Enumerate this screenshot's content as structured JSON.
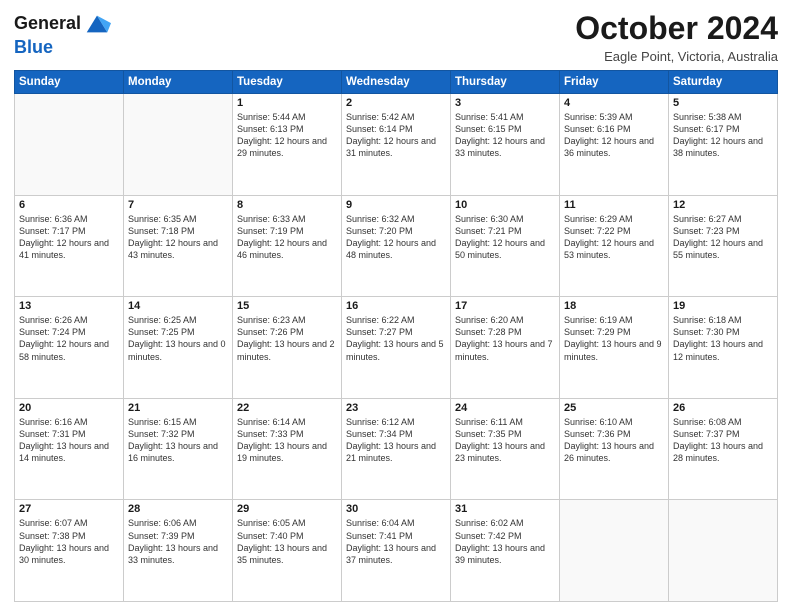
{
  "header": {
    "logo_line1": "General",
    "logo_line2": "Blue",
    "month": "October 2024",
    "location": "Eagle Point, Victoria, Australia"
  },
  "days_of_week": [
    "Sunday",
    "Monday",
    "Tuesday",
    "Wednesday",
    "Thursday",
    "Friday",
    "Saturday"
  ],
  "weeks": [
    [
      {
        "day": "",
        "info": ""
      },
      {
        "day": "",
        "info": ""
      },
      {
        "day": "1",
        "info": "Sunrise: 5:44 AM\nSunset: 6:13 PM\nDaylight: 12 hours and 29 minutes."
      },
      {
        "day": "2",
        "info": "Sunrise: 5:42 AM\nSunset: 6:14 PM\nDaylight: 12 hours and 31 minutes."
      },
      {
        "day": "3",
        "info": "Sunrise: 5:41 AM\nSunset: 6:15 PM\nDaylight: 12 hours and 33 minutes."
      },
      {
        "day": "4",
        "info": "Sunrise: 5:39 AM\nSunset: 6:16 PM\nDaylight: 12 hours and 36 minutes."
      },
      {
        "day": "5",
        "info": "Sunrise: 5:38 AM\nSunset: 6:17 PM\nDaylight: 12 hours and 38 minutes."
      }
    ],
    [
      {
        "day": "6",
        "info": "Sunrise: 6:36 AM\nSunset: 7:17 PM\nDaylight: 12 hours and 41 minutes."
      },
      {
        "day": "7",
        "info": "Sunrise: 6:35 AM\nSunset: 7:18 PM\nDaylight: 12 hours and 43 minutes."
      },
      {
        "day": "8",
        "info": "Sunrise: 6:33 AM\nSunset: 7:19 PM\nDaylight: 12 hours and 46 minutes."
      },
      {
        "day": "9",
        "info": "Sunrise: 6:32 AM\nSunset: 7:20 PM\nDaylight: 12 hours and 48 minutes."
      },
      {
        "day": "10",
        "info": "Sunrise: 6:30 AM\nSunset: 7:21 PM\nDaylight: 12 hours and 50 minutes."
      },
      {
        "day": "11",
        "info": "Sunrise: 6:29 AM\nSunset: 7:22 PM\nDaylight: 12 hours and 53 minutes."
      },
      {
        "day": "12",
        "info": "Sunrise: 6:27 AM\nSunset: 7:23 PM\nDaylight: 12 hours and 55 minutes."
      }
    ],
    [
      {
        "day": "13",
        "info": "Sunrise: 6:26 AM\nSunset: 7:24 PM\nDaylight: 12 hours and 58 minutes."
      },
      {
        "day": "14",
        "info": "Sunrise: 6:25 AM\nSunset: 7:25 PM\nDaylight: 13 hours and 0 minutes."
      },
      {
        "day": "15",
        "info": "Sunrise: 6:23 AM\nSunset: 7:26 PM\nDaylight: 13 hours and 2 minutes."
      },
      {
        "day": "16",
        "info": "Sunrise: 6:22 AM\nSunset: 7:27 PM\nDaylight: 13 hours and 5 minutes."
      },
      {
        "day": "17",
        "info": "Sunrise: 6:20 AM\nSunset: 7:28 PM\nDaylight: 13 hours and 7 minutes."
      },
      {
        "day": "18",
        "info": "Sunrise: 6:19 AM\nSunset: 7:29 PM\nDaylight: 13 hours and 9 minutes."
      },
      {
        "day": "19",
        "info": "Sunrise: 6:18 AM\nSunset: 7:30 PM\nDaylight: 13 hours and 12 minutes."
      }
    ],
    [
      {
        "day": "20",
        "info": "Sunrise: 6:16 AM\nSunset: 7:31 PM\nDaylight: 13 hours and 14 minutes."
      },
      {
        "day": "21",
        "info": "Sunrise: 6:15 AM\nSunset: 7:32 PM\nDaylight: 13 hours and 16 minutes."
      },
      {
        "day": "22",
        "info": "Sunrise: 6:14 AM\nSunset: 7:33 PM\nDaylight: 13 hours and 19 minutes."
      },
      {
        "day": "23",
        "info": "Sunrise: 6:12 AM\nSunset: 7:34 PM\nDaylight: 13 hours and 21 minutes."
      },
      {
        "day": "24",
        "info": "Sunrise: 6:11 AM\nSunset: 7:35 PM\nDaylight: 13 hours and 23 minutes."
      },
      {
        "day": "25",
        "info": "Sunrise: 6:10 AM\nSunset: 7:36 PM\nDaylight: 13 hours and 26 minutes."
      },
      {
        "day": "26",
        "info": "Sunrise: 6:08 AM\nSunset: 7:37 PM\nDaylight: 13 hours and 28 minutes."
      }
    ],
    [
      {
        "day": "27",
        "info": "Sunrise: 6:07 AM\nSunset: 7:38 PM\nDaylight: 13 hours and 30 minutes."
      },
      {
        "day": "28",
        "info": "Sunrise: 6:06 AM\nSunset: 7:39 PM\nDaylight: 13 hours and 33 minutes."
      },
      {
        "day": "29",
        "info": "Sunrise: 6:05 AM\nSunset: 7:40 PM\nDaylight: 13 hours and 35 minutes."
      },
      {
        "day": "30",
        "info": "Sunrise: 6:04 AM\nSunset: 7:41 PM\nDaylight: 13 hours and 37 minutes."
      },
      {
        "day": "31",
        "info": "Sunrise: 6:02 AM\nSunset: 7:42 PM\nDaylight: 13 hours and 39 minutes."
      },
      {
        "day": "",
        "info": ""
      },
      {
        "day": "",
        "info": ""
      }
    ]
  ]
}
